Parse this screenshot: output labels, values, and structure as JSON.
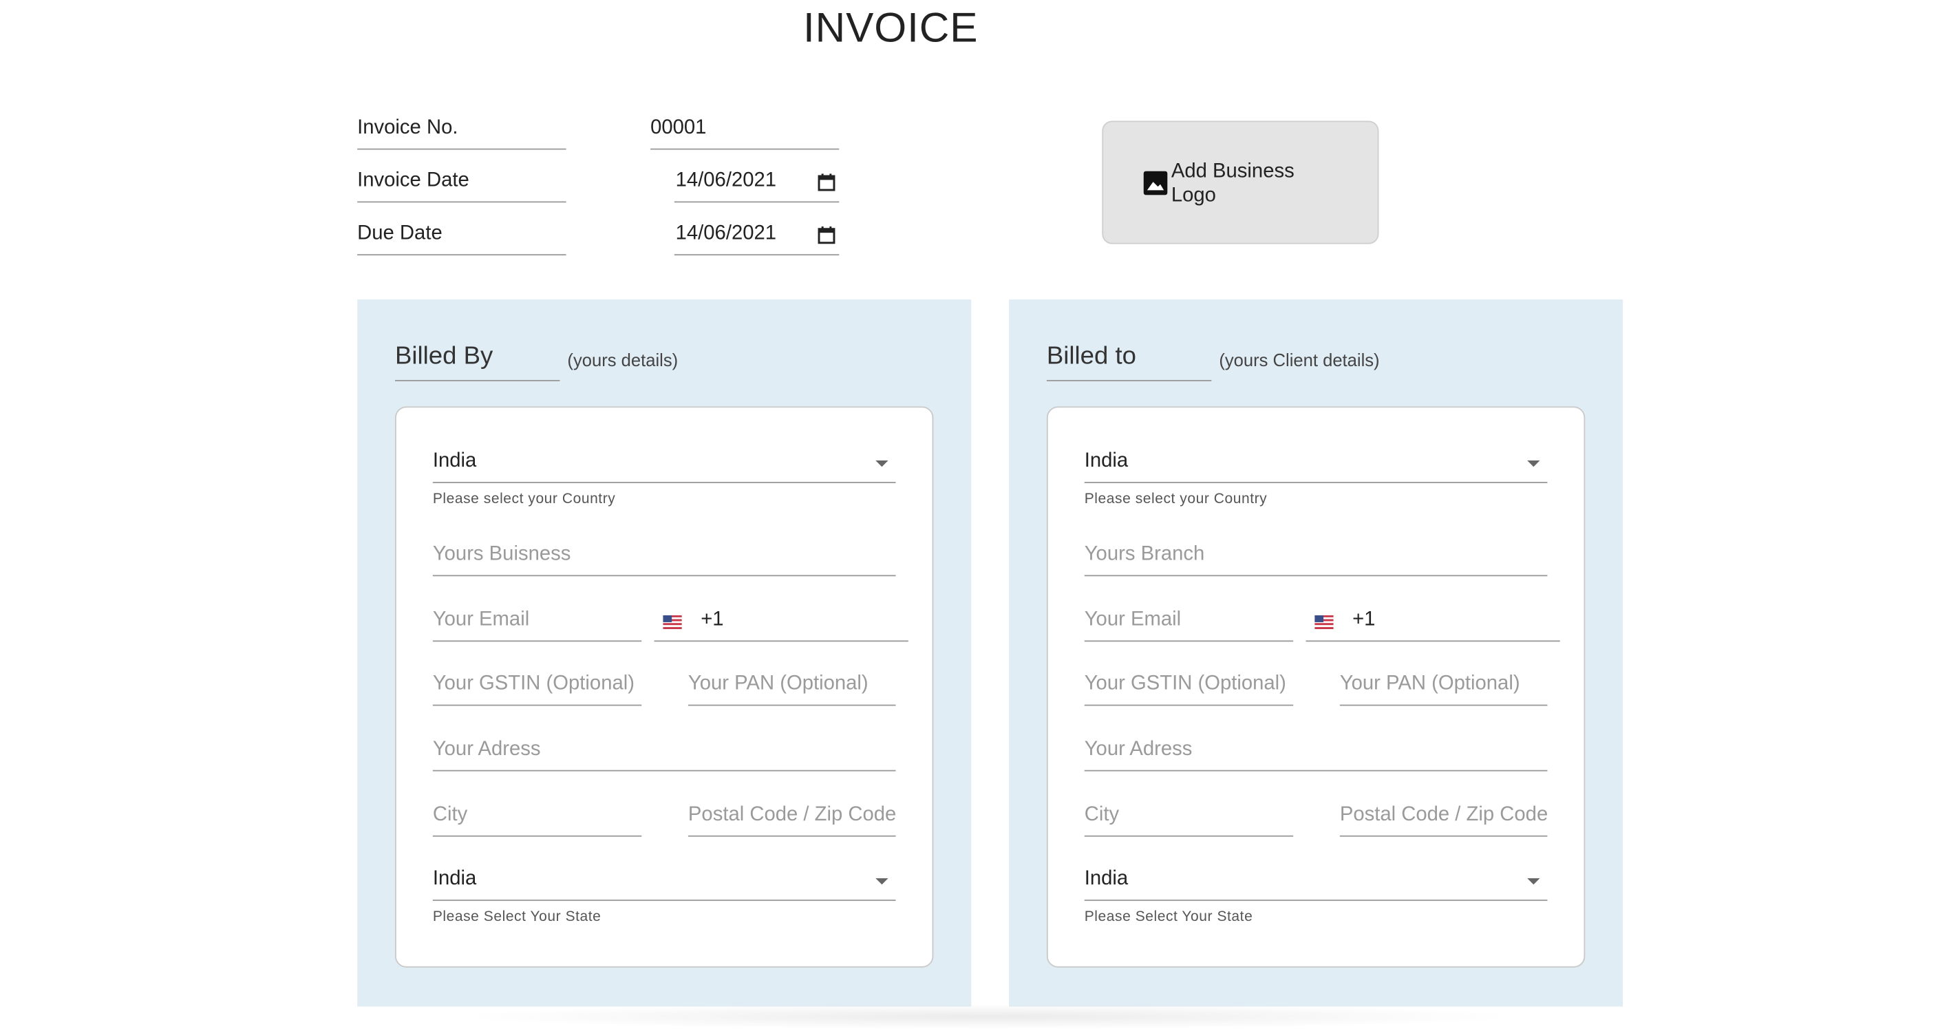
{
  "title": "INVOICE",
  "meta": {
    "invoice_no_label": "Invoice No.",
    "invoice_no_value": "00001",
    "invoice_date_label": "Invoice Date",
    "invoice_date_value": "14/06/2021",
    "due_date_label": "Due Date",
    "due_date_value": "14/06/2021"
  },
  "logo_button": {
    "label": "Add Business Logo",
    "icon": "image-icon"
  },
  "billed_by": {
    "title": "Billed By",
    "subtitle": "(yours details)",
    "country_value": "India",
    "country_helper": "Please select your Country",
    "business_placeholder": "Yours Buisness",
    "email_placeholder": "Your Email",
    "phone_code": "+1",
    "gstin_placeholder": "Your GSTIN (Optional)",
    "pan_placeholder": "Your PAN (Optional)",
    "address_placeholder": "Your Adress",
    "city_placeholder": "City",
    "postal_placeholder": "Postal Code / Zip Code",
    "state_value": "India",
    "state_helper": "Please Select Your State"
  },
  "billed_to": {
    "title": "Billed to",
    "subtitle": "(yours Client details)",
    "country_value": "India",
    "country_helper": "Please select your Country",
    "business_placeholder": "Yours Branch",
    "email_placeholder": "Your Email",
    "phone_code": "+1",
    "gstin_placeholder": "Your GSTIN (Optional)",
    "pan_placeholder": "Your PAN (Optional)",
    "address_placeholder": "Your Adress",
    "city_placeholder": "City",
    "postal_placeholder": "Postal Code / Zip Code",
    "state_value": "India",
    "state_helper": "Please Select Your State"
  },
  "colors": {
    "panel_bg": "#e1edf5",
    "logo_bg": "#e4e4e4"
  }
}
